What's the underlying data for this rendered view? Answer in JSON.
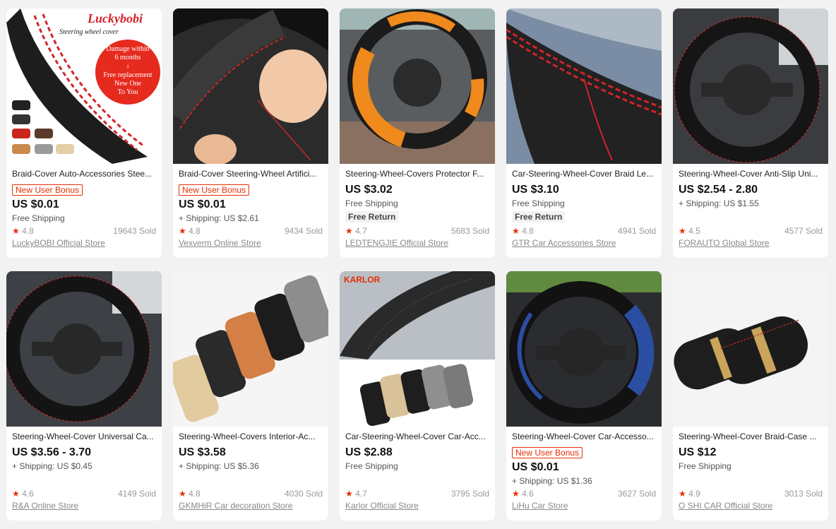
{
  "products": [
    {
      "title": "Braid-Cover Auto-Accessories Stee...",
      "bonus": "New User Bonus",
      "price": "US $0.01",
      "shipping": "Free Shipping",
      "free_return": "",
      "rating": "4.8",
      "sold": "19643 Sold",
      "store": "LuckyBOBI Official Store",
      "image_text": {
        "brand": "Luckybobi",
        "subtitle": "Steering wheel cover",
        "badge_1": "Damage within",
        "badge_2": "6 months",
        "badge_3": "↓",
        "badge_4": "Free replacement",
        "badge_5": "New One",
        "badge_6": "To You"
      }
    },
    {
      "title": "Braid-Cover Steering-Wheel Artifici...",
      "bonus": "New User Bonus",
      "price": "US $0.01",
      "shipping": "+ Shipping: US $2.61",
      "free_return": "",
      "rating": "4.8",
      "sold": "9434 Sold",
      "store": "Vexverm Online Store"
    },
    {
      "title": "Steering-Wheel-Covers Protector F...",
      "bonus": "",
      "price": "US $3.02",
      "shipping": "Free Shipping",
      "free_return": "Free Return",
      "rating": "4.7",
      "sold": "5683 Sold",
      "store": "LEDTENGJIE Official Store"
    },
    {
      "title": "Car-Steering-Wheel-Cover Braid Le...",
      "bonus": "",
      "price": "US $3.10",
      "shipping": "Free Shipping",
      "free_return": "Free Return",
      "rating": "4.8",
      "sold": "4941 Sold",
      "store": "GTR Car Accessories Store"
    },
    {
      "title": "Steering-Wheel-Cover Anti-Slip Uni...",
      "bonus": "",
      "price": "US $2.54 - 2.80",
      "shipping": "+ Shipping: US $1.55",
      "free_return": "",
      "rating": "4.5",
      "sold": "4577 Sold",
      "store": "FORAUTO Global Store"
    },
    {
      "title": "Steering-Wheel-Cover Universal Ca...",
      "bonus": "",
      "price": "US $3.56 - 3.70",
      "shipping": "+ Shipping: US $0.45",
      "free_return": "",
      "rating": "4.6",
      "sold": "4149 Sold",
      "store": "R&A Online Store"
    },
    {
      "title": "Steering-Wheel-Covers Interior-Ac...",
      "bonus": "",
      "price": "US $3.58",
      "shipping": "+ Shipping: US $5.36",
      "free_return": "",
      "rating": "4.8",
      "sold": "4030 Sold",
      "store": "GKMHiR Car decoration Store"
    },
    {
      "title": "Car-Steering-Wheel-Cover Car-Acc...",
      "bonus": "",
      "price": "US $2.88",
      "shipping": "Free Shipping",
      "free_return": "",
      "rating": "4.7",
      "sold": "3795 Sold",
      "store": "Karlor Official Store",
      "image_text": {
        "brand": "KARLOR"
      }
    },
    {
      "title": "Steering-Wheel-Cover Car-Accesso...",
      "bonus": "New User Bonus",
      "price": "US $0.01",
      "shipping": "+ Shipping: US $1.36",
      "free_return": "",
      "rating": "4.6",
      "sold": "3627 Sold",
      "store": "LiHu Car Store"
    },
    {
      "title": "Steering-Wheel-Cover Braid-Case ...",
      "bonus": "",
      "price": "US $12",
      "shipping": "Free Shipping",
      "free_return": "",
      "rating": "4.9",
      "sold": "3013 Sold",
      "store": "O SHI CAR Official Store"
    }
  ],
  "icons": {
    "rating": "star-icon"
  },
  "colors": {
    "accent": "#e62e04",
    "background": "#f2f2f2"
  }
}
